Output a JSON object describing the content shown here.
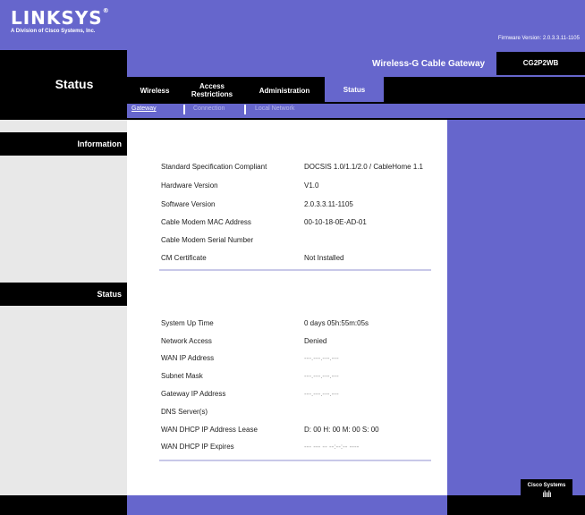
{
  "header": {
    "logo": "LINKSYS",
    "logo_reg": "®",
    "subtitle": "A Division of Cisco Systems, Inc.",
    "firmware": "Firmware Version: 2.0.3.3.11-1105"
  },
  "page_title": "Status",
  "product": {
    "name": "Wireless-G Cable Gateway",
    "model": "CG2P2WB"
  },
  "tabs": [
    {
      "label": "Wireless"
    },
    {
      "label": "Access Restrictions"
    },
    {
      "label": "Administration"
    },
    {
      "label": "Status"
    }
  ],
  "subtabs": [
    {
      "label": "Gateway"
    },
    {
      "label": "Connection"
    },
    {
      "label": "Local Network"
    }
  ],
  "sections": {
    "information": {
      "title": "Information",
      "rows": [
        {
          "label": "Standard Specification Compliant",
          "value": "DOCSIS 1.0/1.1/2.0 / CableHome 1.1"
        },
        {
          "label": "Hardware Version",
          "value": "V1.0"
        },
        {
          "label": "Software Version",
          "value": "2.0.3.3.11-1105"
        },
        {
          "label": "Cable Modem MAC Address",
          "value": "00-10-18-0E-AD-01"
        },
        {
          "label": "Cable Modem Serial Number",
          "value": ""
        },
        {
          "label": "CM Certificate",
          "value": "Not Installed"
        }
      ]
    },
    "status": {
      "title": "Status",
      "rows": [
        {
          "label": "System Up Time",
          "value": "0 days 05h:55m:05s"
        },
        {
          "label": "Network Access",
          "value": "Denied"
        },
        {
          "label": "WAN IP Address",
          "value": "---.---.---.---"
        },
        {
          "label": "Subnet Mask",
          "value": "---.---.---.---"
        },
        {
          "label": "Gateway IP Address",
          "value": "---.---.---.---"
        },
        {
          "label": "DNS Server(s)",
          "value": ""
        },
        {
          "label": "WAN DHCP IP Address Lease",
          "value": "D: 00 H: 00 M: 00 S: 00"
        },
        {
          "label": "WAN DHCP IP Expires",
          "value": "--- --- -- --:--:-- ----"
        }
      ]
    }
  },
  "cisco": {
    "name": "Cisco Systems",
    "bars": "ılıılı"
  },
  "colors": {
    "brand": "#6666cc",
    "black": "#000000",
    "panel": "#e8e8e8"
  }
}
